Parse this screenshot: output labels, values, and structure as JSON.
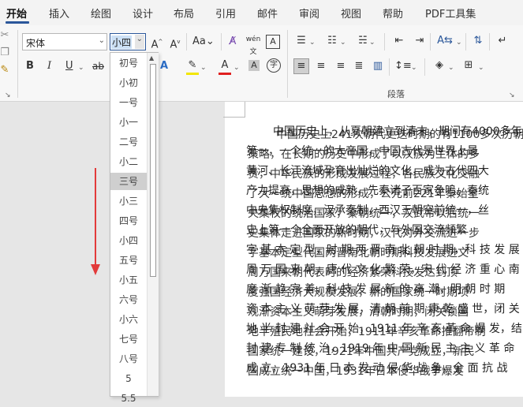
{
  "menu": {
    "tabs": [
      "开始",
      "插入",
      "绘图",
      "设计",
      "布局",
      "引用",
      "邮件",
      "审阅",
      "视图",
      "帮助",
      "PDF工具集"
    ]
  },
  "ribbon": {
    "font_name": "宋体",
    "font_size": "小四",
    "paragraph_label": "段落",
    "font_color": "#e02020",
    "highlight_color": "#f2e600"
  },
  "size_list": {
    "items": [
      "初号",
      "小初",
      "一号",
      "小一",
      "二号",
      "小二",
      "三号",
      "小三",
      "四号",
      "小四",
      "五号",
      "小五",
      "六号",
      "小六",
      "七号",
      "八号",
      "5",
      "5.5"
    ],
    "selected": "三号"
  },
  "document": {
    "lines_a": [
      "中国历史上，从夏朝建立到清末，期间有4000多年",
      "第一，一个统一的大帝国，中国古代是世界上最",
      "黄河、长江流域孕育出灿烂的文化，成为古代四大",
      "产力提高，思想的成熟，先秦诸子百家争鸣。秦统",
      "中央集权制度，汉承秦制，西汉王朝空前统一，丝",
      "史上第一个全面开放的朝代，与外国交流频繁",
      "字 基 本 定 型，时 期 两 晋 南 北 朝 时 期，科 技 发 展",
      "周 万 国 来 朝，唐 代 文 化 繁 荣，宋 代 经 济 重 心 南 移",
      "度 渐 趋 完 善，科 技 发 展 新 的 高 潮，明 朝 时 期",
      "资 本 主 义 萌 芽 发 展，清 朝 前 期 康 乾 盛 世，闭 关",
      "地 半 封 建 社 会 开 始，1911 年 辛 亥 革 命 爆 发，结 束",
      "封 建 专 制 统 治，1919 年 中 国 新 民 主 主 义 革 命",
      "成 立，1931 年 日 本 发 动 侵 华 战 争，全 面 抗 战"
    ],
    "lines_b": [
      "中国历史上241次朝代更迭时期的有1100多次历朝",
      "策略，在长期的历史中形成了以汉族为主体的多",
      "贵，中华民族的形成发展过程，各民族文化交融",
      "了大一统中国思想的形成，公元前221年秦始皇",
      "央集权的统治国家，秦朝统一，汉武帝以后统一",
      "史集体走进国家的新时期，汉代对外交流进一步",
      "字基本定型代国两晋南北朝时期科技发展进文",
      "周万国来朝代表时的经济繁荣科技发达到顶",
      "度强国经济大规模发展，新的国家统一时期项",
      "观渐资本主义萌芽发展，清朝时期，闭关锁国",
      "地半殖民地社会开始，1911年辛亥革命推翻帝制",
      "国家统一建设，1921年中国共产党成立，新民",
      "国成立统一中国，1931年日本侵华战争爆发"
    ]
  }
}
